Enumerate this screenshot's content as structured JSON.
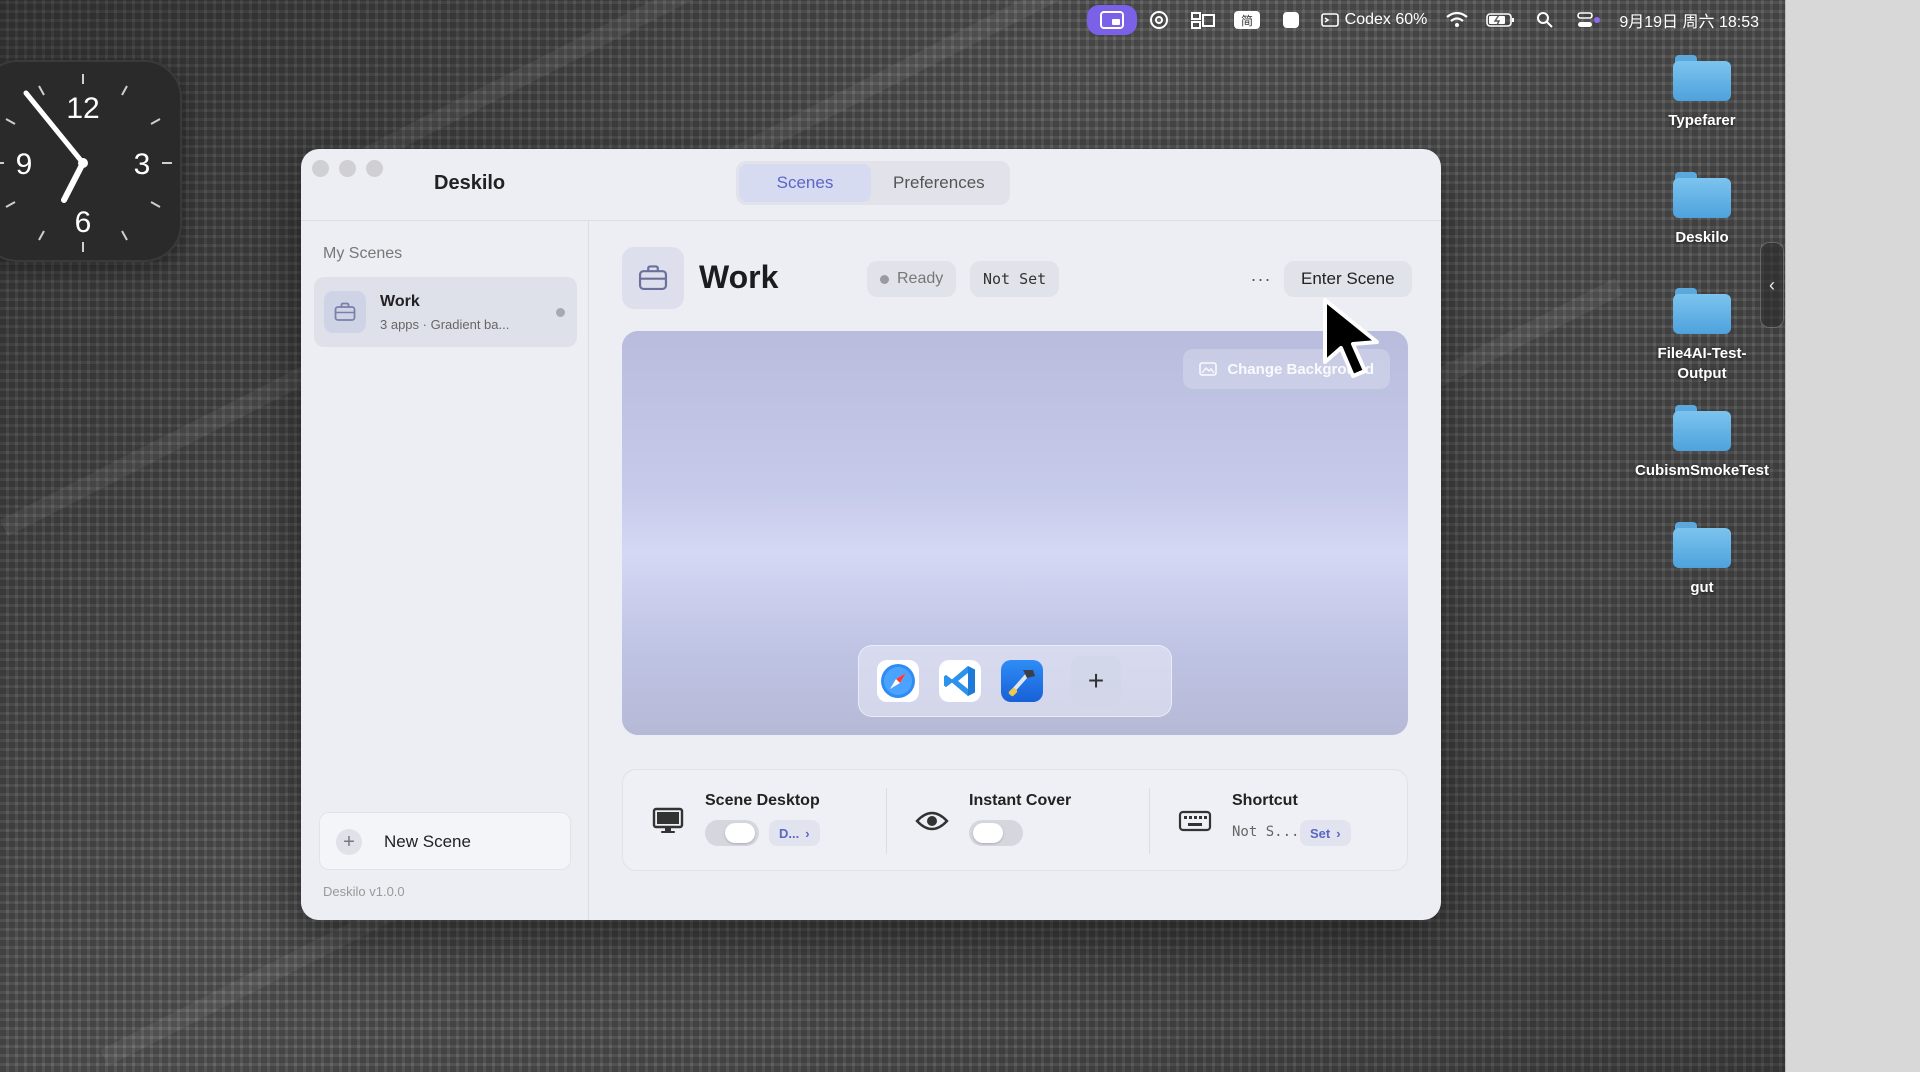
{
  "menubar": {
    "codex_status": "Codex 60%",
    "datetime": "9月19日 周六  18:53",
    "icons": [
      "deskilo-menubar-icon",
      "openai-icon",
      "stage-manager-icon",
      "input-method-icon",
      "square-icon",
      "codex-icon",
      "wifi-icon",
      "battery-icon",
      "spotlight-icon",
      "control-center-icon"
    ]
  },
  "clock": {
    "numerals": [
      "12",
      "3",
      "6",
      "9"
    ]
  },
  "desktop_icons": [
    {
      "label": "Typefarer"
    },
    {
      "label": "Deskilo"
    },
    {
      "label": "File4AI-Test-Output"
    },
    {
      "label": "CubismSmokeTest"
    },
    {
      "label": "gut"
    }
  ],
  "window": {
    "title": "Deskilo",
    "tabs": [
      {
        "label": "Scenes",
        "active": true
      },
      {
        "label": "Preferences",
        "active": false
      }
    ],
    "sidebar": {
      "header": "My Scenes",
      "scenes": [
        {
          "name": "Work",
          "subtitle": "3 apps · Gradient ba...",
          "icon": "briefcase-icon"
        }
      ],
      "new_scene_label": "New Scene",
      "version": "Deskilo v1.0.0"
    },
    "scene": {
      "title": "Work",
      "status": "Ready",
      "shortcut_badge": "Not Set",
      "more_label": "···",
      "enter_label": "Enter Scene",
      "change_background_label": "Change Background",
      "dock_apps": [
        "safari-icon",
        "vscode-icon",
        "xcode-icon"
      ],
      "add_app_label": "+"
    },
    "settings": {
      "scene_desktop": {
        "title": "Scene Desktop",
        "enabled": true,
        "pill": "D..."
      },
      "instant_cover": {
        "title": "Instant Cover",
        "enabled": false
      },
      "shortcut": {
        "title": "Shortcut",
        "value": "Not S...",
        "pill": "Set"
      }
    }
  },
  "colors": {
    "accent": "#5a67c4",
    "menubar_active": "#7b61e8",
    "window_bg": "#eceef4"
  }
}
